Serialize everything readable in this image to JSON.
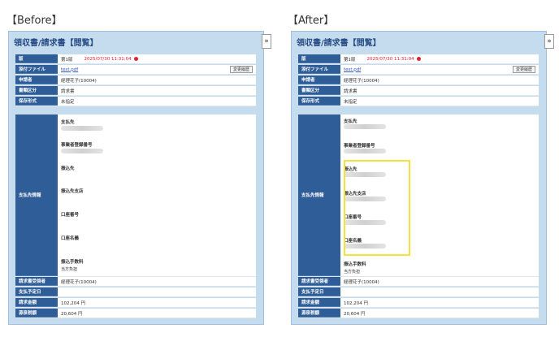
{
  "captions": {
    "before": "【Before】",
    "after": "【After】"
  },
  "panel": {
    "title": "領収書/請求書【閲覧】",
    "collapse": "»"
  },
  "rows_top": [
    {
      "label": "版",
      "value": "第1版",
      "date": "2025/07/30 11:31:04"
    },
    {
      "label": "添付ファイル",
      "value": "test.pdf",
      "button": "変更履歴"
    },
    {
      "label": "申請者",
      "value": "経理花子(10004)"
    },
    {
      "label": "書類区分",
      "value": "請求書"
    },
    {
      "label": "保存形式",
      "value": "未指定"
    }
  ],
  "payee_label": "支払先情報",
  "fields": {
    "shiharaisaki": "支払先",
    "jigyosha": "事業者登録番号",
    "furikomisaki": "振込先",
    "shiten": "振込先支店",
    "koza_bango": "口座番号",
    "koza_meigi": "口座名義",
    "tesuryo": "振込手数料",
    "tesuryo_value": "当方負担"
  },
  "rows_bottom": [
    {
      "label": "請求書受領者",
      "value": "経理花子(10004)"
    },
    {
      "label": "支払予定日",
      "value": ""
    },
    {
      "label": "請求金額",
      "value": "102,204 円"
    },
    {
      "label": "源泉税額",
      "value": "20,604 円"
    }
  ],
  "colors": {
    "label_bg": "#2f5d97",
    "panel_bg": "#c5dbee",
    "highlight": "#f5e23a"
  }
}
